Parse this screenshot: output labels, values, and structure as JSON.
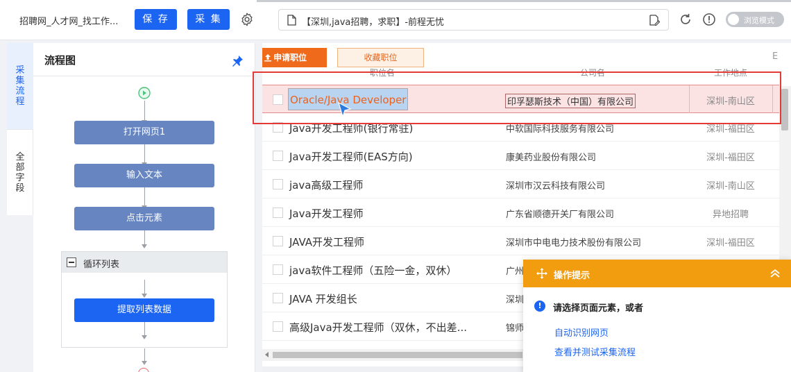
{
  "toolbar": {
    "app_title": "招聘网_人才网_找工作...",
    "save_label": "保 存",
    "collect_label": "采 集",
    "url": "【深圳,java招聘，求职】-前程无忧",
    "mode_label": "浏览模式"
  },
  "side_tabs": {
    "collect_flow": [
      "采",
      "集",
      "流",
      "程"
    ],
    "all_fields": [
      "全",
      "部",
      "字",
      "段"
    ]
  },
  "flow": {
    "title": "流程图",
    "nodes": {
      "open_page": "打开网页1",
      "input_text": "输入文本",
      "click_element": "点击元素",
      "loop_list": "循环列表",
      "extract_list": "提取列表数据"
    }
  },
  "web": {
    "apply_label": "申请职位",
    "favorite_label": "收藏职位",
    "trunc_char": "E",
    "columns": {
      "job": "职位名",
      "company": "公司名",
      "location": "工作地点"
    },
    "rows": [
      {
        "job": "Oracle/Java Developer",
        "company": "印孚瑟斯技术（中国）有限公司",
        "location": "深圳-南山区"
      },
      {
        "job": "Java开发工程师(银行常驻)",
        "company": "中软国际科技服务有限公司",
        "location": "深圳-福田区"
      },
      {
        "job": "Java开发工程师(EAS方向)",
        "company": "康美药业股份有限公司",
        "location": "深圳-福田区"
      },
      {
        "job": "java高级工程师",
        "company": "深圳市汉云科技有限公司",
        "location": "深圳-南山区"
      },
      {
        "job": "Java开发工程师",
        "company": "广东省顺德开关厂有限公司",
        "location": "异地招聘"
      },
      {
        "job": "JAVA开发工程师",
        "company": "深圳市中电电力技术股份有限公司",
        "location": "深圳-福田区"
      },
      {
        "job": "java软件工程师（五险一金，双休）",
        "company": "广州",
        "location": ""
      },
      {
        "job": "JAVA 开发组长",
        "company": "深圳",
        "location": ""
      },
      {
        "job": "高级Java开发工程师（双休，不出差...",
        "company": "锦师",
        "location": ""
      }
    ]
  },
  "hint": {
    "title": "操作提示",
    "alert_mark": "!",
    "message": "请选择页面元素，或者",
    "link_auto": "自动识别网页",
    "link_test": "查看并测试采集流程"
  },
  "colors": {
    "primary": "#1c64f2",
    "flow_node": "#6785c1",
    "apply_orange": "#f06a1c",
    "hint_orange": "#f29d0f",
    "highlight_red": "#e53935"
  }
}
